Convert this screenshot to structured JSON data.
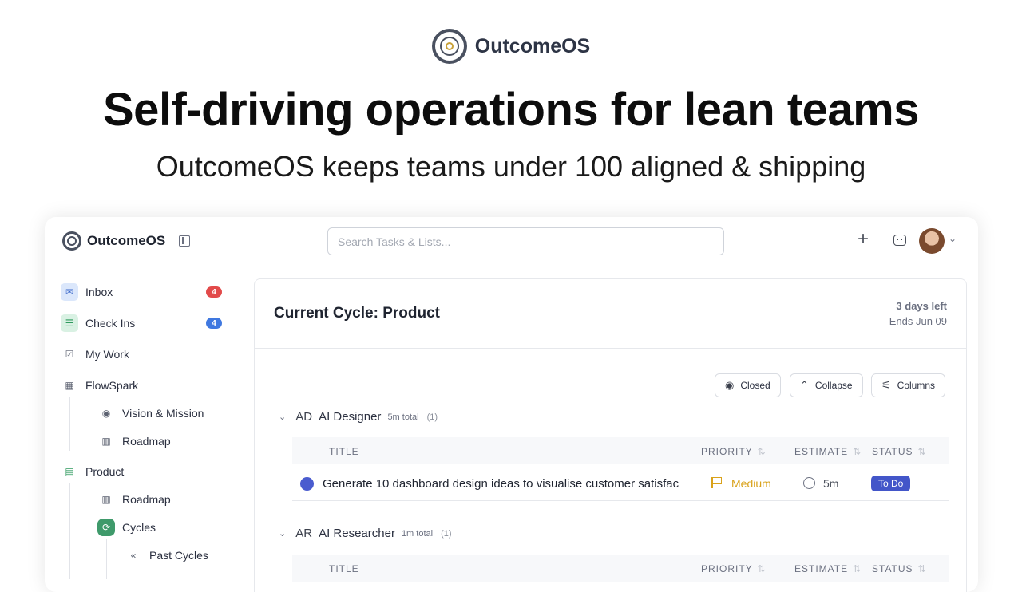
{
  "hero": {
    "brand": "OutcomeOS",
    "title": "Self-driving operations for lean teams",
    "subtitle": "OutcomeOS keeps teams under 100 aligned & shipping"
  },
  "app": {
    "name": "OutcomeOS",
    "search_placeholder": "Search Tasks & Lists..."
  },
  "sidebar": {
    "items": [
      {
        "label": "Inbox",
        "icon": "inbox-icon",
        "badge": "4"
      },
      {
        "label": "Check Ins",
        "icon": "checklist-icon",
        "badge": "4"
      },
      {
        "label": "My Work",
        "icon": "checkbox-icon"
      },
      {
        "label": "FlowSpark",
        "icon": "building-icon"
      },
      {
        "label": "Vision & Mission",
        "icon": "eye-icon"
      },
      {
        "label": "Roadmap",
        "icon": "map-icon"
      },
      {
        "label": "Product",
        "icon": "briefcase-icon"
      },
      {
        "label": "Roadmap",
        "icon": "map-icon"
      },
      {
        "label": "Cycles",
        "icon": "cycle-icon"
      },
      {
        "label": "Past Cycles",
        "icon": "double-chevron-left-icon"
      }
    ]
  },
  "cycle": {
    "title": "Current Cycle: Product",
    "days_left": "3 days left",
    "ends": "Ends Jun 09"
  },
  "toolbar": {
    "closed_label": "Closed",
    "collapse_label": "Collapse",
    "columns_label": "Columns"
  },
  "table_headers": {
    "title": "TITLE",
    "priority": "PRIORITY",
    "estimate": "ESTIMATE",
    "status": "STATUS"
  },
  "groups": [
    {
      "abbr": "AD",
      "name": "AI Designer",
      "total": "5m total",
      "count": "(1)",
      "rows": [
        {
          "title": "Generate 10 dashboard design ideas to visualise customer satisfac",
          "priority": "Medium",
          "estimate": "5m",
          "status": "To Do"
        }
      ]
    },
    {
      "abbr": "AR",
      "name": "AI Researcher",
      "total": "1m total",
      "count": "(1)"
    }
  ],
  "colors": {
    "badge_red": "#e24a4a",
    "badge_blue": "#3f78e0",
    "priority_medium": "#d9a21b",
    "status_todo": "#4356c9",
    "cycles_active": "#3f9a6b"
  }
}
